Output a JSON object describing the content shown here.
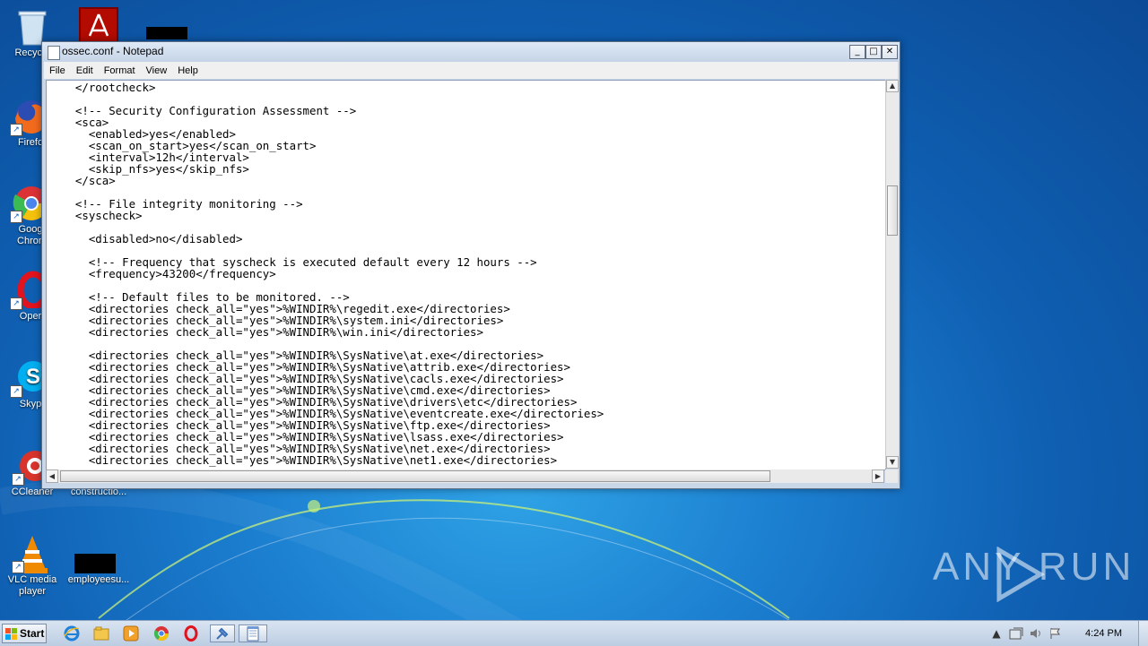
{
  "desktop": {
    "icons": [
      {
        "label": "Recycle",
        "icon": "recycle-bin-icon"
      },
      {
        "label": "",
        "icon": "adobe-acrobat-icon"
      },
      {
        "label": "Firefo",
        "icon": "firefox-icon"
      },
      {
        "label": "Goog Chron",
        "icon": "chrome-icon"
      },
      {
        "label": "Oper",
        "icon": "opera-icon"
      },
      {
        "label": "Skyp",
        "icon": "skype-icon"
      },
      {
        "label": "CCleaner",
        "icon": "ccleaner-icon"
      },
      {
        "label": "constructio...",
        "icon": "document-icon"
      },
      {
        "label": "VLC media player",
        "icon": "vlc-icon"
      },
      {
        "label": "employeesu...",
        "icon": "document-icon"
      }
    ],
    "watermark": "ANY RUN"
  },
  "window": {
    "title": "ossec.conf - Notepad",
    "menu": [
      "File",
      "Edit",
      "Format",
      "View",
      "Help"
    ],
    "content": "  </rootcheck>\n\n  <!-- Security Configuration Assessment -->\n  <sca>\n    <enabled>yes</enabled>\n    <scan_on_start>yes</scan_on_start>\n    <interval>12h</interval>\n    <skip_nfs>yes</skip_nfs>\n  </sca>\n\n  <!-- File integrity monitoring -->\n  <syscheck>\n\n    <disabled>no</disabled>\n\n    <!-- Frequency that syscheck is executed default every 12 hours -->\n    <frequency>43200</frequency>\n\n    <!-- Default files to be monitored. -->\n    <directories check_all=\"yes\">%WINDIR%\\regedit.exe</directories>\n    <directories check_all=\"yes\">%WINDIR%\\system.ini</directories>\n    <directories check_all=\"yes\">%WINDIR%\\win.ini</directories>\n\n    <directories check_all=\"yes\">%WINDIR%\\SysNative\\at.exe</directories>\n    <directories check_all=\"yes\">%WINDIR%\\SysNative\\attrib.exe</directories>\n    <directories check_all=\"yes\">%WINDIR%\\SysNative\\cacls.exe</directories>\n    <directories check_all=\"yes\">%WINDIR%\\SysNative\\cmd.exe</directories>\n    <directories check_all=\"yes\">%WINDIR%\\SysNative\\drivers\\etc</directories>\n    <directories check_all=\"yes\">%WINDIR%\\SysNative\\eventcreate.exe</directories>\n    <directories check_all=\"yes\">%WINDIR%\\SysNative\\ftp.exe</directories>\n    <directories check_all=\"yes\">%WINDIR%\\SysNative\\lsass.exe</directories>\n    <directories check_all=\"yes\">%WINDIR%\\SysNative\\net.exe</directories>\n    <directories check_all=\"yes\">%WINDIR%\\SysNative\\net1.exe</directories>"
  },
  "taskbar": {
    "start_label": "Start",
    "items": [
      "internet-explorer-icon",
      "file-explorer-icon",
      "media-player-icon",
      "chrome-icon",
      "opera-icon",
      "tool-icon",
      "notepad-icon"
    ],
    "clock": "4:24 PM"
  },
  "colors": {
    "accent": "#1c7fd0",
    "window_frame": "#c9d7e8"
  }
}
